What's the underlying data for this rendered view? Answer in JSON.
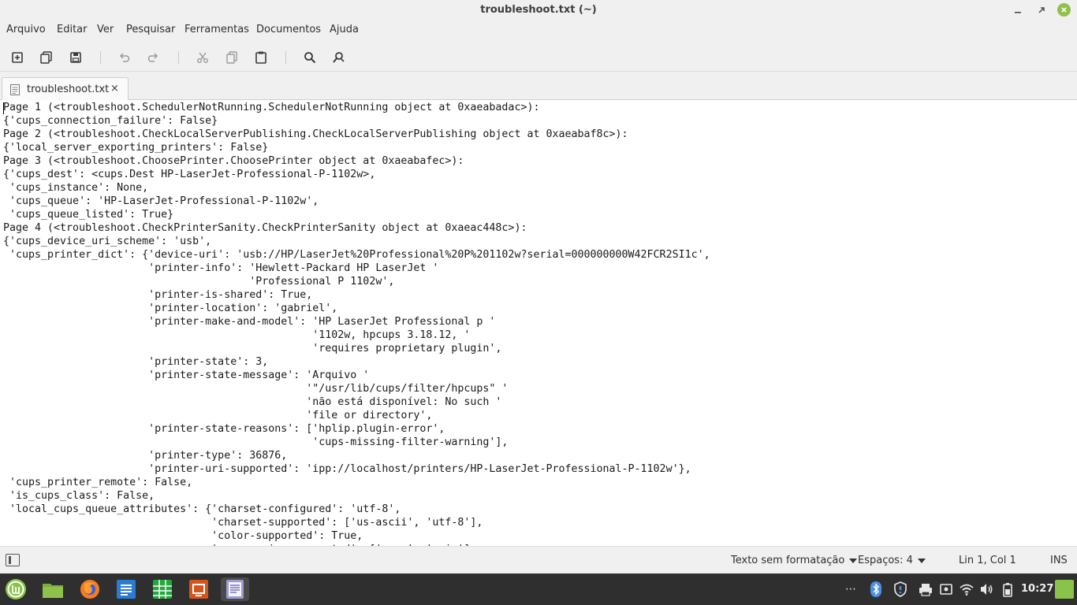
{
  "window": {
    "title": "troubleshoot.txt (~)"
  },
  "menu": [
    "Arquivo",
    "Editar",
    "Ver",
    "Pesquisar",
    "Ferramentas",
    "Documentos",
    "Ajuda"
  ],
  "tab": {
    "label": "troubleshoot.txt",
    "close": "×"
  },
  "editor": {
    "lines": [
      "Page 1 (<troubleshoot.SchedulerNotRunning.SchedulerNotRunning object at 0xaeabadac>):",
      "{'cups_connection_failure': False}",
      "Page 2 (<troubleshoot.CheckLocalServerPublishing.CheckLocalServerPublishing object at 0xaeabaf8c>):",
      "{'local_server_exporting_printers': False}",
      "Page 3 (<troubleshoot.ChoosePrinter.ChoosePrinter object at 0xaeabafec>):",
      "{'cups_dest': <cups.Dest HP-LaserJet-Professional-P-1102w>,",
      " 'cups_instance': None,",
      " 'cups_queue': 'HP-LaserJet-Professional-P-1102w',",
      " 'cups_queue_listed': True}",
      "Page 4 (<troubleshoot.CheckPrinterSanity.CheckPrinterSanity object at 0xaeac448c>):",
      "{'cups_device_uri_scheme': 'usb',",
      " 'cups_printer_dict': {'device-uri': 'usb://HP/LaserJet%20Professional%20P%201102w?serial=000000000W42FCR2SI1c',",
      "                       'printer-info': 'Hewlett-Packard HP LaserJet '",
      "                                       'Professional P 1102w',",
      "                       'printer-is-shared': True,",
      "                       'printer-location': 'gabriel',",
      "                       'printer-make-and-model': 'HP LaserJet Professional p '",
      "                                                 '1102w, hpcups 3.18.12, '",
      "                                                 'requires proprietary plugin',",
      "                       'printer-state': 3,",
      "                       'printer-state-message': 'Arquivo '",
      "                                                '\"/usr/lib/cups/filter/hpcups\" '",
      "                                                'não está disponível: No such '",
      "                                                'file or directory',",
      "                       'printer-state-reasons': ['hplip.plugin-error',",
      "                                                 'cups-missing-filter-warning'],",
      "                       'printer-type': 36876,",
      "                       'printer-uri-supported': 'ipp://localhost/printers/HP-LaserJet-Professional-P-1102w'},",
      " 'cups_printer_remote': False,",
      " 'is_cups_class': False,",
      " 'local_cups_queue_attributes': {'charset-configured': 'utf-8',",
      "                                 'charset-supported': ['us-ascii', 'utf-8'],",
      "                                 'color-supported': True,",
      "                                 'compression-supported': ['none', 'gzip'],"
    ]
  },
  "status": {
    "syntax": "Texto sem formatação",
    "indent": "Espaços: 4",
    "position": "Lin 1, Col 1",
    "mode": "INS"
  },
  "taskbar": {
    "apps": [
      "mint-menu-icon",
      "files-icon",
      "firefox-icon",
      "writer-icon",
      "calc-icon",
      "impress-icon",
      "text-editor-icon"
    ],
    "clock": "10:27"
  }
}
